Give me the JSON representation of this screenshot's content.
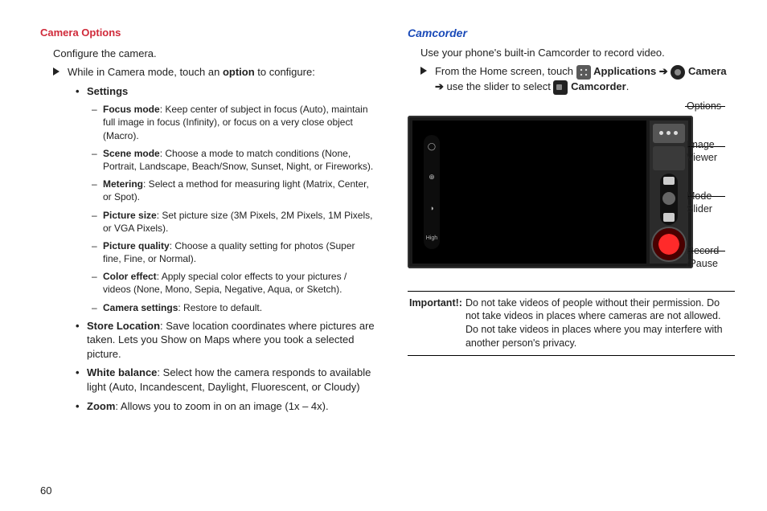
{
  "page_number": "60",
  "left": {
    "heading": "Camera Options",
    "intro": "Configure the camera.",
    "step": "While in Camera mode, touch an ",
    "step_bold": "option",
    "step_tail": " to configure:",
    "settings_label": "Settings",
    "items": {
      "focus_b": "Focus mode",
      "focus_t": ": Keep center of subject in focus (Auto), maintain full image in focus (Infinity), or focus on a very close object (Macro).",
      "scene_b": "Scene mode",
      "scene_t": ": Choose a mode to match conditions (None, Portrait, Landscape, Beach/Snow, Sunset, Night, or Fireworks).",
      "meter_b": "Metering",
      "meter_t": ": Select a method for measuring light (Matrix, Center, or Spot).",
      "psize_b": "Picture size",
      "psize_t": ": Set picture size (3M Pixels, 2M Pixels, 1M Pixels, or VGA Pixels).",
      "pqual_b": "Picture quality",
      "pqual_t": ": Choose a quality setting for photos (Super fine, Fine, or Normal).",
      "color_b": "Color effect",
      "color_t": ": Apply special color effects to your pictures / videos (None, Mono, Sepia, Negative, Aqua, or Sketch).",
      "camset_b": "Camera settings",
      "camset_t": ": Restore to default.",
      "store_b": "Store Location",
      "store_t": ": Save location coordinates where pictures are taken. Lets you Show on Maps where you took a selected picture.",
      "wb_b": "White balance",
      "wb_t": ": Select how the camera responds to available light (Auto, Incandescent, Daylight, Fluorescent, or Cloudy)",
      "zoom_b": "Zoom",
      "zoom_t": ": Allows you to zoom in on an image (1x – 4x)."
    }
  },
  "right": {
    "heading": "Camcorder",
    "intro": "Use your phone's built-in Camcorder to record video.",
    "step_a": "From the Home screen, touch ",
    "apps": "Applications",
    "arrow": " ➔ ",
    "camera": "Camera",
    "step_b": " use the slider to select ",
    "camcorder": "Camcorder",
    "period": ".",
    "labels": {
      "options": "Options",
      "viewer": "Image Viewer",
      "slider": "Mode Slider",
      "record": "Record /Pause"
    },
    "important_label": "Important!:",
    "important_text": "Do not take videos of people without their permission. Do not take videos in places where cameras are not allowed. Do not take videos in places where you may interfere with another person's privacy."
  }
}
